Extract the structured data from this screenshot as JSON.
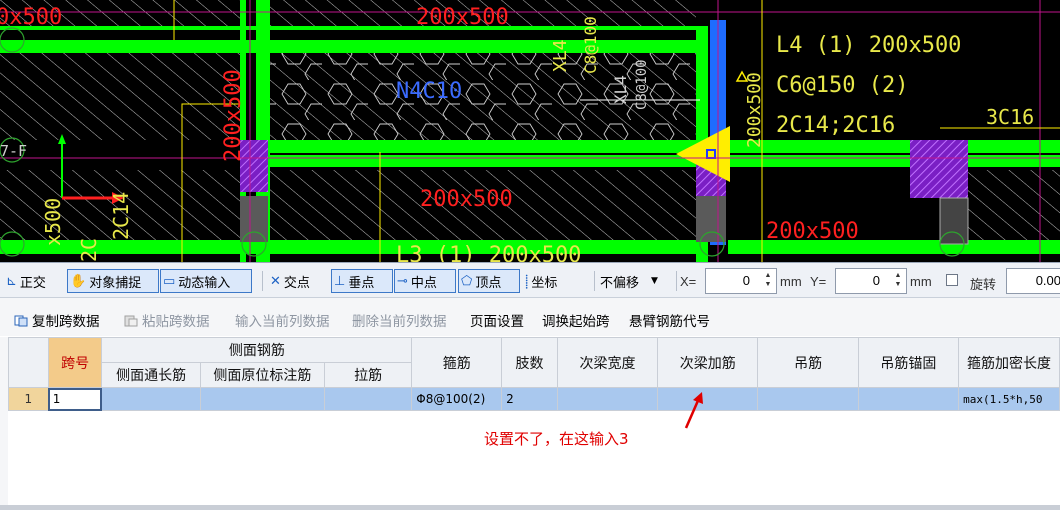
{
  "cad": {
    "labels": {
      "top_left_partial": "0x500",
      "top_center": "200x500",
      "left_vertical": "200x500",
      "hatch_label": "N4C10",
      "mid_label": "200x500",
      "beam_info_line1": "L4 (1)  200x500",
      "beam_info_line2": "C6@150 (2)",
      "beam_info_line3": "2C14;2C16",
      "right_label": "3C16",
      "bottom_right": "200x500",
      "bottom_center": "L3 (1)  200x500",
      "axis_left_bottom": "2C14",
      "vert_small_1": "XL4",
      "vert_small_2": "C8@100",
      "left_axis_label": "7-F",
      "left_small_v": "x500",
      "left_small_v2": "2C"
    }
  },
  "snapbar": {
    "ortho": "正交",
    "object_snap": "对象捕捉",
    "dynamic_input": "动态输入",
    "intersection": "交点",
    "perpendicular": "垂点",
    "midpoint": "中点",
    "vertex": "顶点",
    "coordinate": "坐标",
    "offset_mode": "不偏移",
    "x_label": "X=",
    "x_value": "0",
    "x_unit": "mm",
    "y_label": "Y=",
    "y_value": "0",
    "y_unit": "mm",
    "rotate_label": "旋转",
    "rotate_value": "0.00"
  },
  "editbar": {
    "copy_span": "复制跨数据",
    "paste_span": "粘贴跨数据",
    "input_column": "输入当前列数据",
    "delete_column": "删除当前列数据",
    "page_setup": "页面设置",
    "swap_start": "调换起始跨",
    "cantilever_code": "悬臂钢筋代号"
  },
  "grid": {
    "headers": {
      "span_no": "跨号",
      "side_rebar_group": "侧面钢筋",
      "side_through": "侧面通长筋",
      "side_orig": "侧面原位标注筋",
      "tie": "拉筋",
      "stirrup": "箍筋",
      "legs": "肢数",
      "sec_beam_width": "次梁宽度",
      "sec_beam_rebar": "次梁加筋",
      "hanger": "吊筋",
      "hanger_anchor": "吊筋锚固",
      "dense_length": "箍筋加密长度"
    },
    "rows": [
      {
        "row_no": "1",
        "span_no": "1",
        "side_through": "",
        "side_orig": "",
        "tie": "",
        "stirrup": "Φ8@100(2)",
        "legs": "2",
        "sec_beam_width": "",
        "sec_beam_rebar": "",
        "hanger": "",
        "hanger_anchor": "",
        "dense_length": "max(1.5*h,50"
      }
    ]
  },
  "annotation": {
    "text": "设置不了，在这输入3",
    "color": "#e00000"
  },
  "colors": {
    "beam_green": "#00ff00",
    "cad_bg": "#000000",
    "cad_text_yellow": "#e8e84a",
    "column_purple": "#9b30e0",
    "row_selected": "#a9c8ee",
    "header_selected": "#f3cb8a"
  }
}
